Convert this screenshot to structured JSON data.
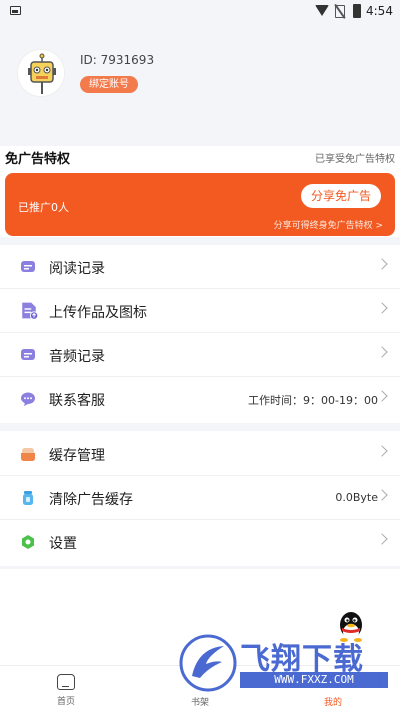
{
  "status_bar": {
    "time": "4:54"
  },
  "profile": {
    "user_id": "ID: 7931693",
    "bind_label": "绑定账号"
  },
  "ad_free": {
    "title": "免广告特权",
    "subtitle": "已享受免广告特权",
    "promo_count": "已推广0人",
    "share_label": "分享免广告",
    "hint": "分享可得终身免广告特权 >"
  },
  "menu_group_1": [
    {
      "label": "阅读记录",
      "icon": "reading-record-icon",
      "value": ""
    },
    {
      "label": "上传作品及图标",
      "icon": "upload-document-icon",
      "value": ""
    },
    {
      "label": "音频记录",
      "icon": "audio-record-icon",
      "value": ""
    },
    {
      "label": "联系客服",
      "icon": "customer-service-icon",
      "value": "工作时间：9：00-19：00"
    }
  ],
  "menu_group_2": [
    {
      "label": "缓存管理",
      "icon": "cache-manage-icon",
      "value": ""
    },
    {
      "label": "清除广告缓存",
      "icon": "clear-cache-icon",
      "value": "0.0Byte"
    },
    {
      "label": "设置",
      "icon": "settings-icon",
      "value": ""
    }
  ],
  "bottom_nav": {
    "home": "首页",
    "shelf": "书架",
    "mine": "我的"
  },
  "watermark": {
    "title": "飞翔下载",
    "url": "WWW.FXXZ.COM"
  },
  "colors": {
    "accent": "#f25a22",
    "bg_gray": "#f4f5f9",
    "icon_purple": "#8b7fe0",
    "watermark_blue": "#3b5ecf"
  }
}
